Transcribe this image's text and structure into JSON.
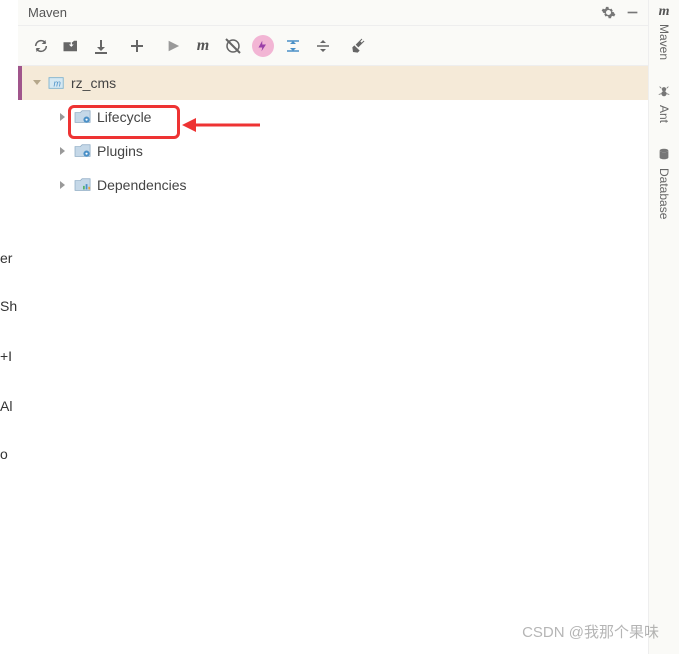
{
  "header": {
    "title": "Maven"
  },
  "toolbar": {
    "refresh": "refresh",
    "generate": "generate",
    "download": "download",
    "add": "add",
    "run": "run",
    "m": "m",
    "skip": "skip",
    "bolt": "bolt",
    "collapse1": "c1",
    "collapse2": "c2",
    "wrench": "wrench"
  },
  "tree": {
    "root": {
      "label": "rz_cms"
    },
    "children": [
      {
        "label": "Lifecycle"
      },
      {
        "label": "Plugins"
      },
      {
        "label": "Dependencies"
      }
    ]
  },
  "leftCut": {
    "a": "er",
    "b": "Sh",
    "c": "+I",
    "d": "Al",
    "e": "o"
  },
  "rail": {
    "maven": "Maven",
    "ant": "Ant",
    "database": "Database"
  },
  "watermark": "CSDN @我那个果味"
}
